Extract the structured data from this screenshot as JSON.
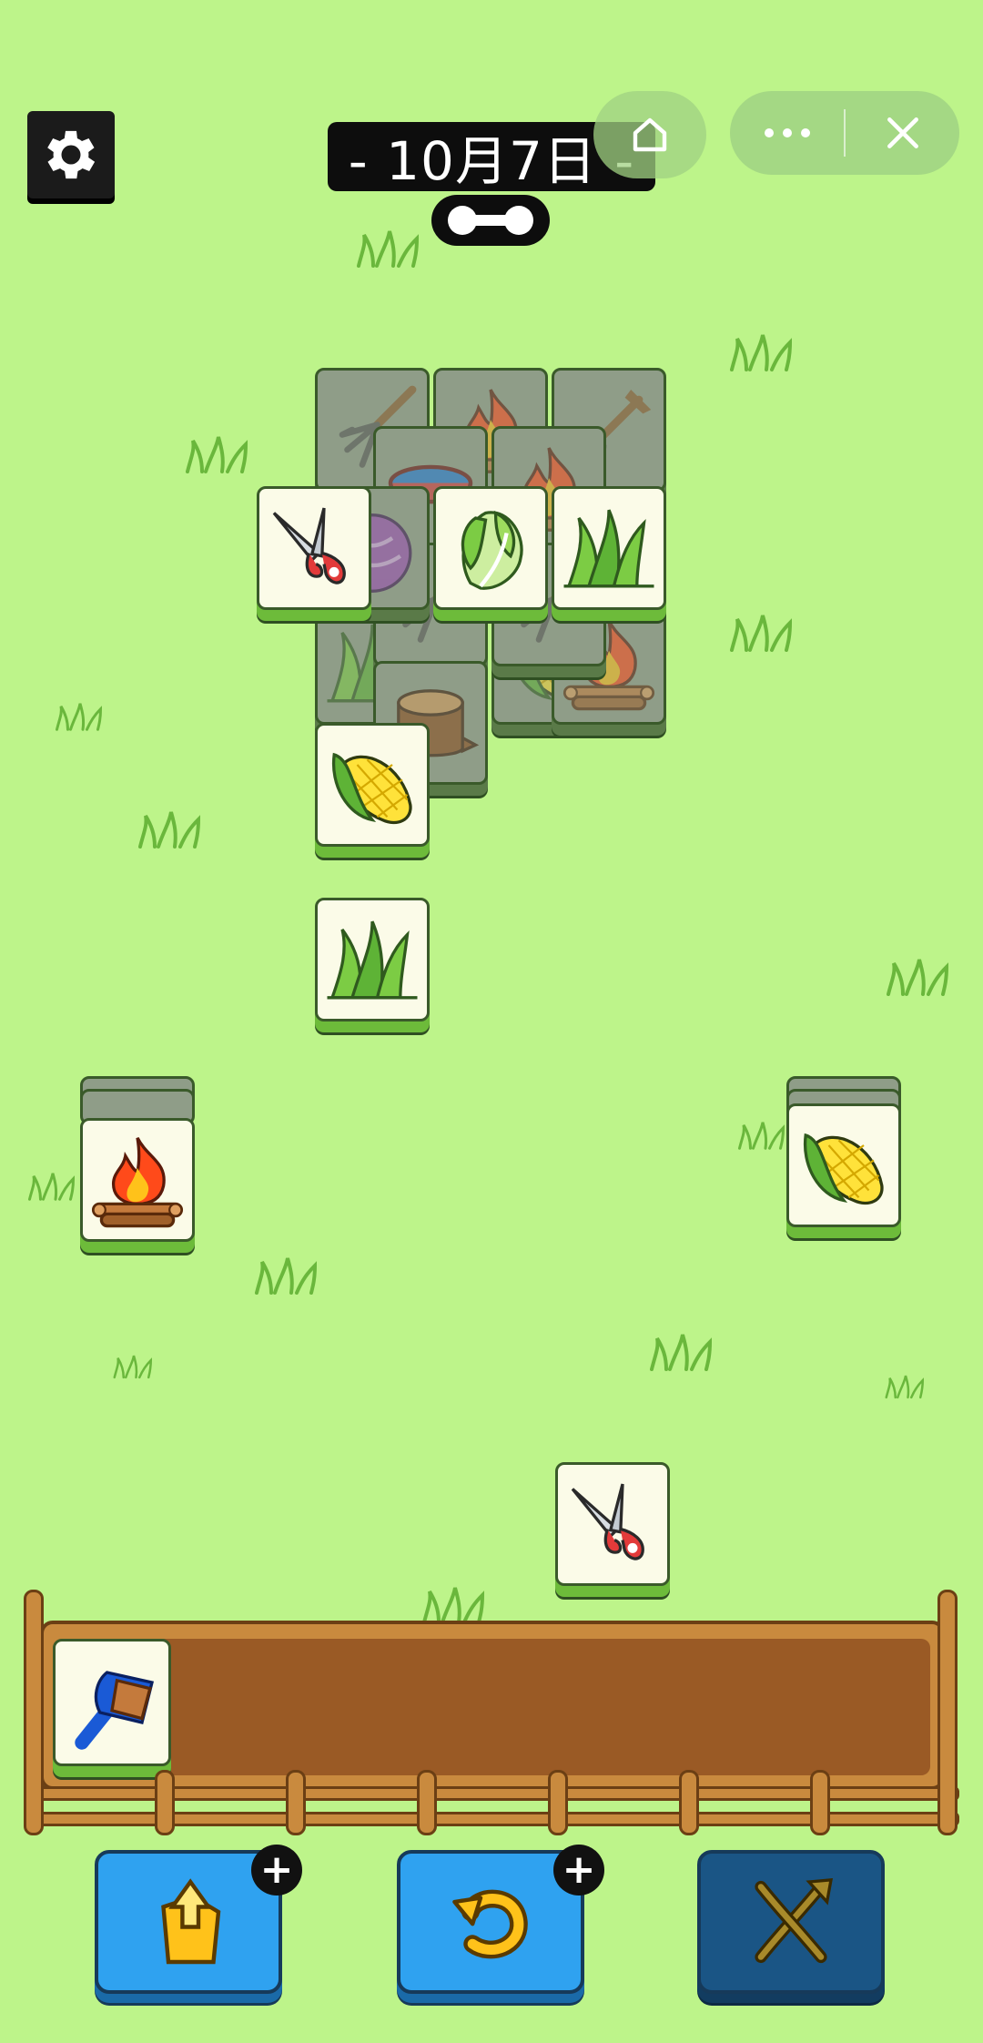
{
  "header": {
    "date_label": "- 10月7日 -"
  },
  "icons": {
    "settings": "gear-icon",
    "home": "home-icon",
    "more": "more-dots-icon",
    "close": "close-icon"
  },
  "board": {
    "tiles": [
      {
        "item": "pitchfork",
        "state": "blocked"
      },
      {
        "item": "fire",
        "state": "blocked"
      },
      {
        "item": "shovel",
        "state": "blocked"
      },
      {
        "item": "water-bowl",
        "state": "blocked"
      },
      {
        "item": "fire",
        "state": "blocked"
      },
      {
        "item": "scissors",
        "state": "free"
      },
      {
        "item": "cabbage-purple",
        "state": "blocked"
      },
      {
        "item": "napa-cabbage",
        "state": "free"
      },
      {
        "item": "grass",
        "state": "free"
      },
      {
        "item": "corn",
        "state": "free"
      },
      {
        "item": "grass",
        "state": "free"
      },
      {
        "item": "campfire",
        "state": "free"
      },
      {
        "item": "corn",
        "state": "free"
      },
      {
        "item": "scissors",
        "state": "free"
      }
    ]
  },
  "tray": {
    "slots": [
      {
        "item": "brush"
      }
    ]
  },
  "tools": [
    {
      "name": "pop-out",
      "badge": "+"
    },
    {
      "name": "undo",
      "badge": "+"
    },
    {
      "name": "shuffle",
      "badge": ""
    }
  ],
  "colors": {
    "background": "#bdf48a",
    "tile_face": "#fbfbe8",
    "tile_blocked": "#8f9d88",
    "button_blue": "#2fa2f0",
    "fence_wood": "#c98a3e"
  }
}
